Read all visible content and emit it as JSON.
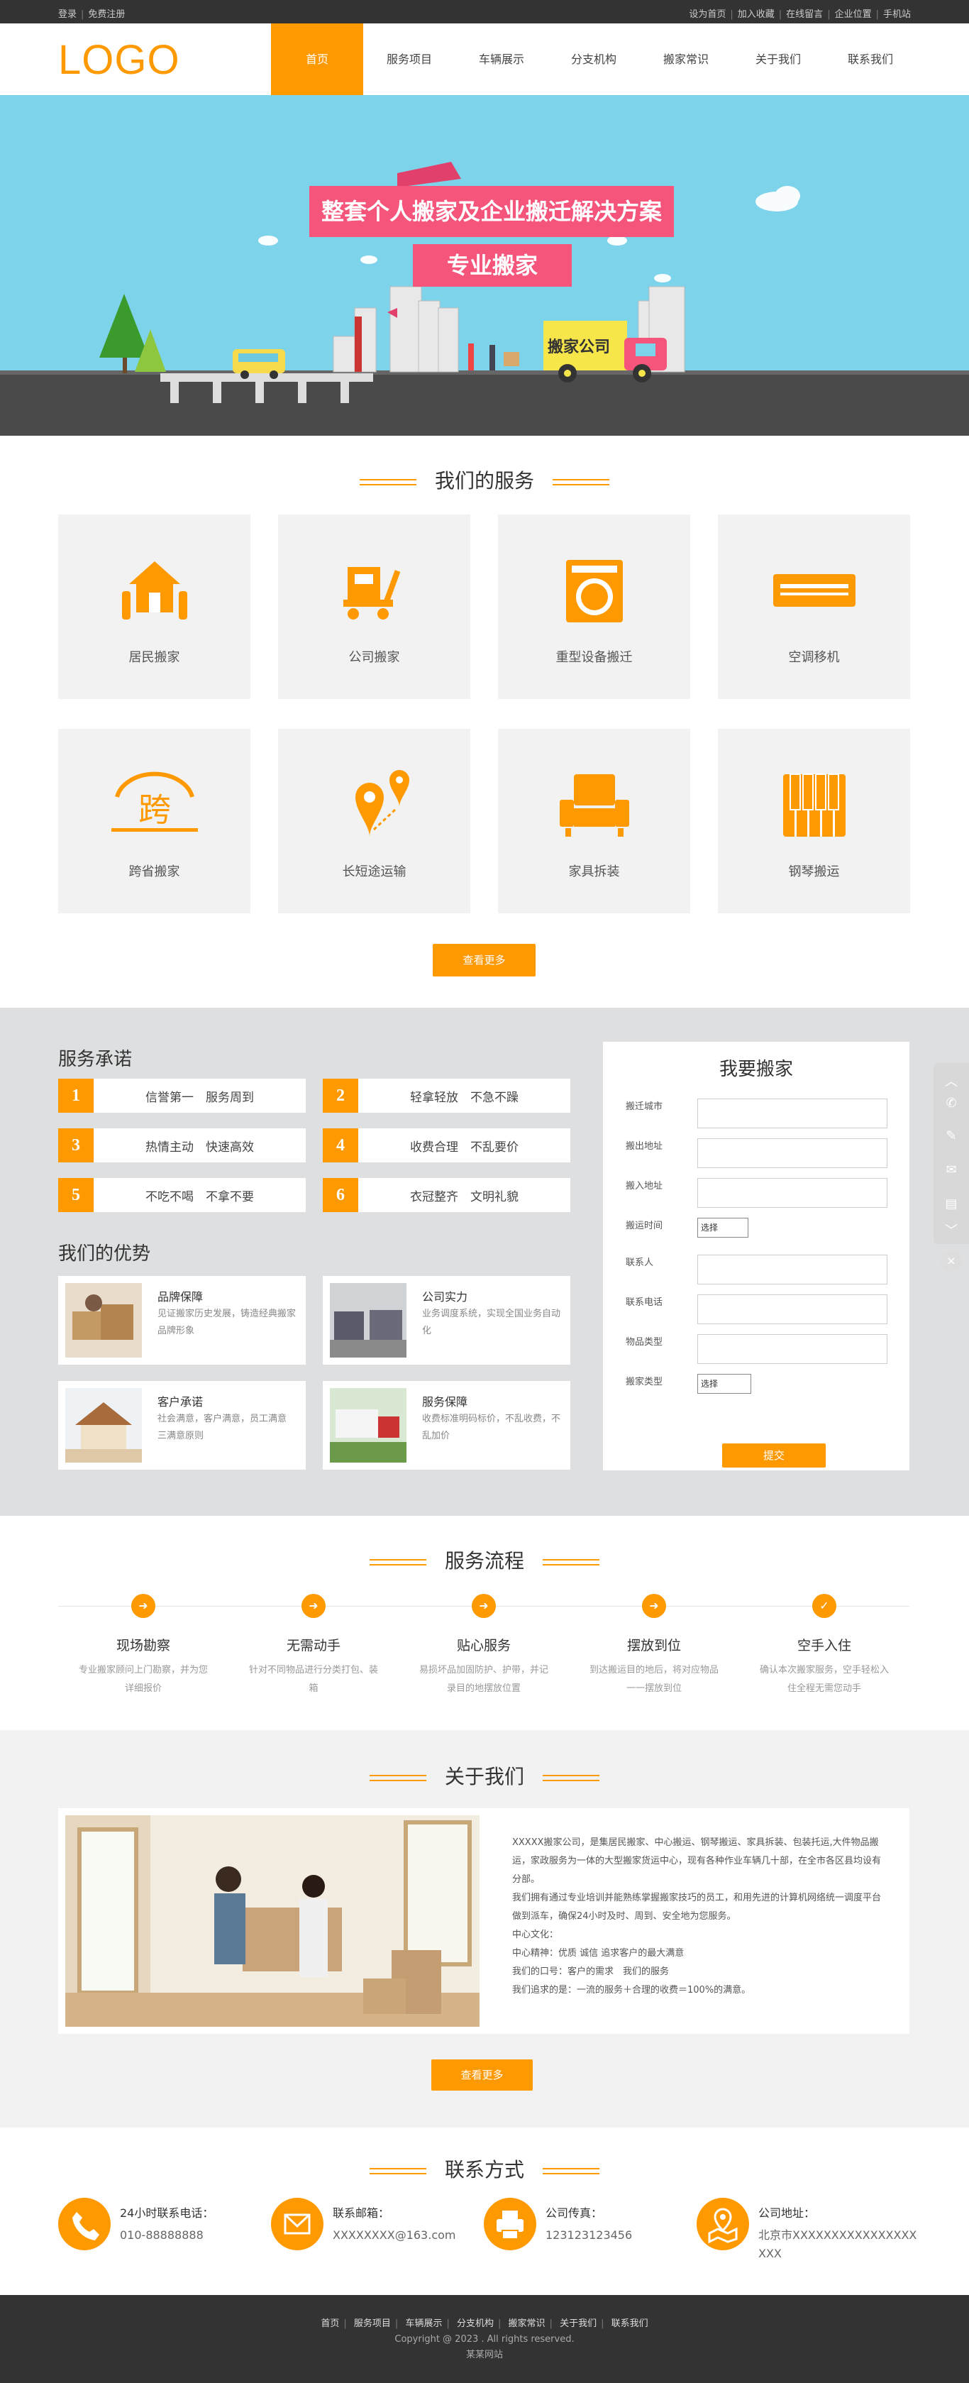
{
  "topbar": {
    "left": [
      "登录",
      "免费注册"
    ],
    "right": [
      "设为首页",
      "加入收藏",
      "在线留言",
      "企业位置",
      "手机站"
    ]
  },
  "header": {
    "logo": "LOGO",
    "nav": [
      "首页",
      "服务项目",
      "车辆展示",
      "分支机构",
      "搬家常识",
      "关于我们",
      "联系我们"
    ],
    "active": "首页"
  },
  "banner": {
    "headline": "整套个人搬家及企业搬迁解决方案",
    "subline": "专业搬家",
    "truck_label": "搬家公司"
  },
  "services": {
    "title": "我们的服务",
    "items": [
      {
        "label": "居民搬家",
        "icon": "house-hands-icon"
      },
      {
        "label": "公司搬家",
        "icon": "cart-box-icon"
      },
      {
        "label": "重型设备搬迁",
        "icon": "washing-machine-icon"
      },
      {
        "label": "空调移机",
        "icon": "air-conditioner-icon"
      },
      {
        "label": "跨省搬家",
        "icon": "cross-province-icon"
      },
      {
        "label": "长短途运输",
        "icon": "route-pin-icon"
      },
      {
        "label": "家具拆装",
        "icon": "sofa-icon"
      },
      {
        "label": "钢琴搬运",
        "icon": "piano-keys-icon"
      }
    ],
    "more": "查看更多"
  },
  "promise": {
    "title": "服务承诺",
    "items": [
      {
        "n": "1",
        "t": "信誉第一　服务周到"
      },
      {
        "n": "2",
        "t": "轻拿轻放　不急不躁"
      },
      {
        "n": "3",
        "t": "热情主动　快速高效"
      },
      {
        "n": "4",
        "t": "收费合理　不乱要价"
      },
      {
        "n": "5",
        "t": "不吃不喝　不拿不要"
      },
      {
        "n": "6",
        "t": "衣冠整齐　文明礼貌"
      }
    ]
  },
  "advantages": {
    "title": "我们的优势",
    "items": [
      {
        "title": "品牌保障",
        "desc": "见证搬家历史发展，铸造经典搬家品牌形象"
      },
      {
        "title": "公司实力",
        "desc": "业务调度系统，实现全国业务自动化"
      },
      {
        "title": "客户承诺",
        "desc": "社会满意，客户满意，员工满意 三满意原则"
      },
      {
        "title": "服务保障",
        "desc": "收费标准明码标价，不乱收费，不乱加价"
      }
    ]
  },
  "form": {
    "title": "我要搬家",
    "fields": [
      "搬迁城市",
      "搬出地址",
      "搬入地址",
      "搬运时间",
      "联系人",
      "联系电话",
      "物品类型",
      "搬家类型"
    ],
    "select_value": "选择",
    "submit": "提交"
  },
  "process": {
    "title": "服务流程",
    "steps": [
      {
        "title": "现场勘察",
        "desc": "专业搬家顾问上门勘察，并为您详细报价"
      },
      {
        "title": "无需动手",
        "desc": "针对不同物品进行分类打包、装箱"
      },
      {
        "title": "贴心服务",
        "desc": "易损坏品加固防护、护带，并记录目的地摆放位置"
      },
      {
        "title": "摆放到位",
        "desc": "到达搬运目的地后，将对应物品一一摆放到位"
      },
      {
        "title": "空手入住",
        "desc": "确认本次搬家服务，空手轻松入住全程无需您动手"
      }
    ]
  },
  "about": {
    "title": "关于我们",
    "paragraphs": [
      "XXXXX搬家公司，是集居民搬家、中心搬运、钢琴搬运、家具拆装、包装托运,大件物品搬运，家政服务为一体的大型搬家货运中心，现有各种作业车辆几十部，在全市各区县均设有分部。",
      "我们拥有通过专业培训并能熟练掌握搬家技巧的员工，和用先进的计算机网络统一调度平台做到派车，确保24小时及时、周到、安全地为您服务。",
      "中心文化：",
      "中心精神：优质 诚信 追求客户的最大满意",
      "我们的口号：客户的需求　我们的服务",
      "我们追求的是：一流的服务＋合理的收费＝100%的满意。"
    ],
    "more": "查看更多"
  },
  "contact": {
    "title": "联系方式",
    "items": [
      {
        "label": "24小时联系电话：",
        "value": "010-88888888",
        "icon": "phone-icon"
      },
      {
        "label": "联系邮箱：",
        "value": "XXXXXXXX@163.com",
        "icon": "mail-icon"
      },
      {
        "label": "公司传真：",
        "value": "123123123456",
        "icon": "fax-icon"
      },
      {
        "label": "公司地址：",
        "value": "北京市XXXXXXXXXXXXXXXXXXX",
        "icon": "location-icon"
      }
    ]
  },
  "footer": {
    "links": [
      "首页",
      "服务项目",
      "车辆展示",
      "分支机构",
      "搬家常识",
      "关于我们",
      "联系我们"
    ],
    "copyright": "Copyright @ 2023 . All rights reserved.",
    "site": "某某网站"
  },
  "colors": {
    "accent": "#ff9900",
    "banner_sky": "#7dd3ea",
    "ribbon": "#f6557b",
    "dark": "#333333"
  }
}
